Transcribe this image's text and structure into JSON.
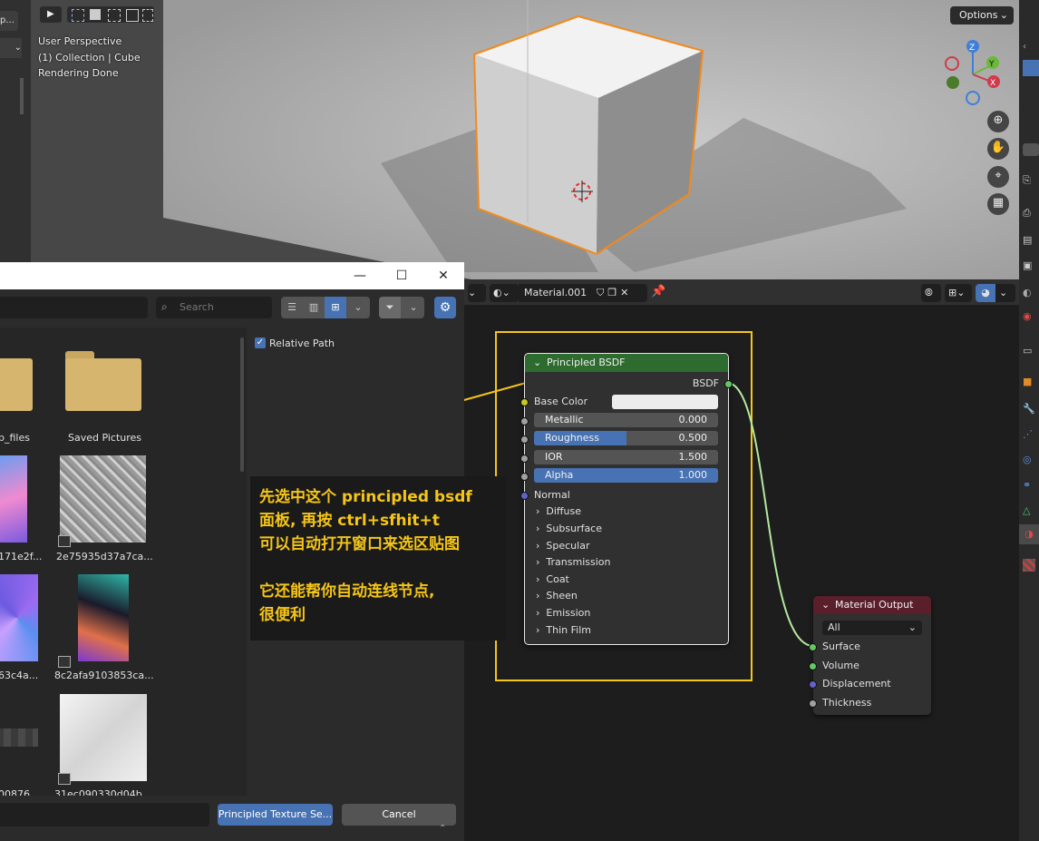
{
  "viewport": {
    "overlay_lines": [
      "User Perspective",
      "(1) Collection | Cube",
      "Rendering Done"
    ],
    "options_label": "Options",
    "left_truncated_label": "p..."
  },
  "node_header": {
    "material_name": "Material.001"
  },
  "principled_node": {
    "title": "Principled BSDF",
    "output": "BSDF",
    "base_color_label": "Base Color",
    "sliders": [
      {
        "label": "Metallic",
        "value": "0.000",
        "fill": 0,
        "highlight": false
      },
      {
        "label": "Roughness",
        "value": "0.500",
        "fill": 0.5,
        "highlight": true
      },
      {
        "label": "IOR",
        "value": "1.500",
        "fill": 0,
        "highlight": false
      },
      {
        "label": "Alpha",
        "value": "1.000",
        "fill": 1.0,
        "highlight": true
      }
    ],
    "normal_label": "Normal",
    "panels": [
      "Diffuse",
      "Subsurface",
      "Specular",
      "Transmission",
      "Coat",
      "Sheen",
      "Emission",
      "Thin Film"
    ]
  },
  "output_node": {
    "title": "Material Output",
    "target": "All",
    "inputs": [
      "Surface",
      "Volume",
      "Displacement",
      "Thickness"
    ]
  },
  "file_dialog": {
    "search_placeholder": "Search",
    "relative_path_label": "Relative Path",
    "relative_path_checked": true,
    "items": [
      {
        "label": "p_files"
      },
      {
        "label": "Saved Pictures"
      },
      {
        "label": "171e2f..."
      },
      {
        "label": "2e75935d37a7ca..."
      },
      {
        "label": "63c4a..."
      },
      {
        "label": "8c2afa9103853ca..."
      },
      {
        "label": "00876..."
      },
      {
        "label": "31ec090330d04b..."
      }
    ],
    "confirm_label": "Principled Texture Se...",
    "cancel_label": "Cancel"
  },
  "annotation": {
    "lines": [
      "先选中这个 principled bsdf",
      "面板, 再按 ctrl+sfhit+t",
      "可以自动打开窗口来选区贴图",
      "",
      "它还能帮你自动连线节点,",
      "很便利"
    ]
  },
  "colors": {
    "accent": "#4772b3",
    "selection_orange": "#f28a1b",
    "annotation_yellow": "#f5c518",
    "bsdf_header": "#2e6b2e",
    "output_header": "#5a1f2b"
  }
}
